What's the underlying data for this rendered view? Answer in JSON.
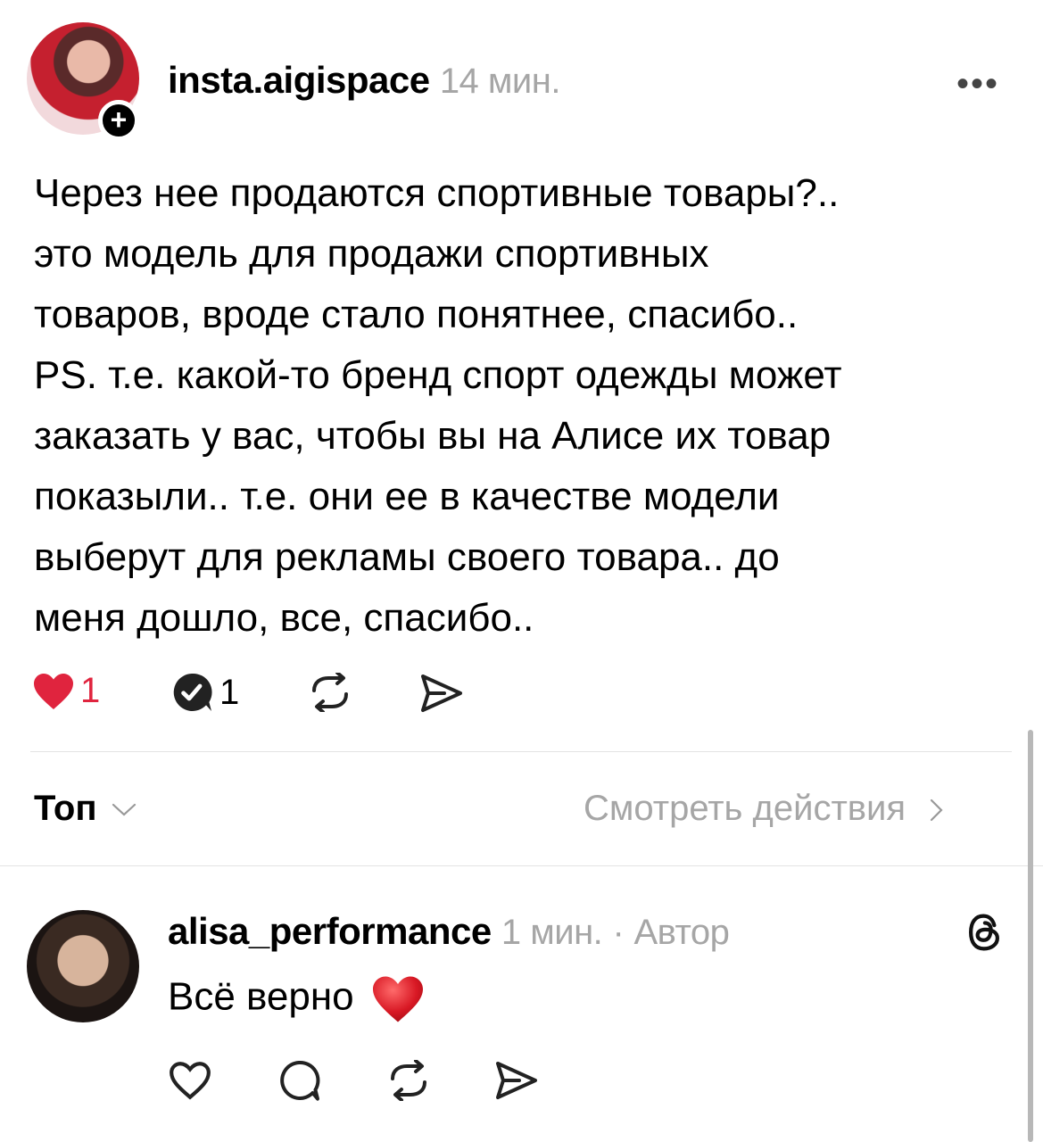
{
  "post": {
    "username": "insta.aigispace",
    "time": "14 мин.",
    "more_label": "•••",
    "follow_badge": "+",
    "lines": [
      "Через нее продаются спортивные товары?..",
      "это модель для продажи спортивных",
      "товаров, вроде стало понятнее, спасибо..",
      "PS. т.е. какой-то бренд спорт одежды может",
      "заказать у вас, чтобы вы на Алисе их товар",
      "показыли.. т.е. они ее в качестве модели",
      "выберут для рекламы своего товара.. до",
      "меня дошло, все, спасибо.."
    ],
    "like_count": "1",
    "reply_count": "1",
    "like_color": "#e0243e"
  },
  "filter": {
    "sort_label": "Топ",
    "view_actions_label": "Смотреть действия"
  },
  "reply": {
    "username": "alisa_performance",
    "time": "1 мин.",
    "separator": "·",
    "role": "Автор",
    "text": "Всё верно",
    "emoji": "❤️"
  },
  "icons": {
    "heart_filled": "heart-icon",
    "comment": "comment-icon",
    "repost": "repost-icon",
    "share": "share-icon",
    "threads": "threads-icon",
    "chevron_down": "chevron-down-icon",
    "chevron_right": "chevron-right-icon"
  }
}
